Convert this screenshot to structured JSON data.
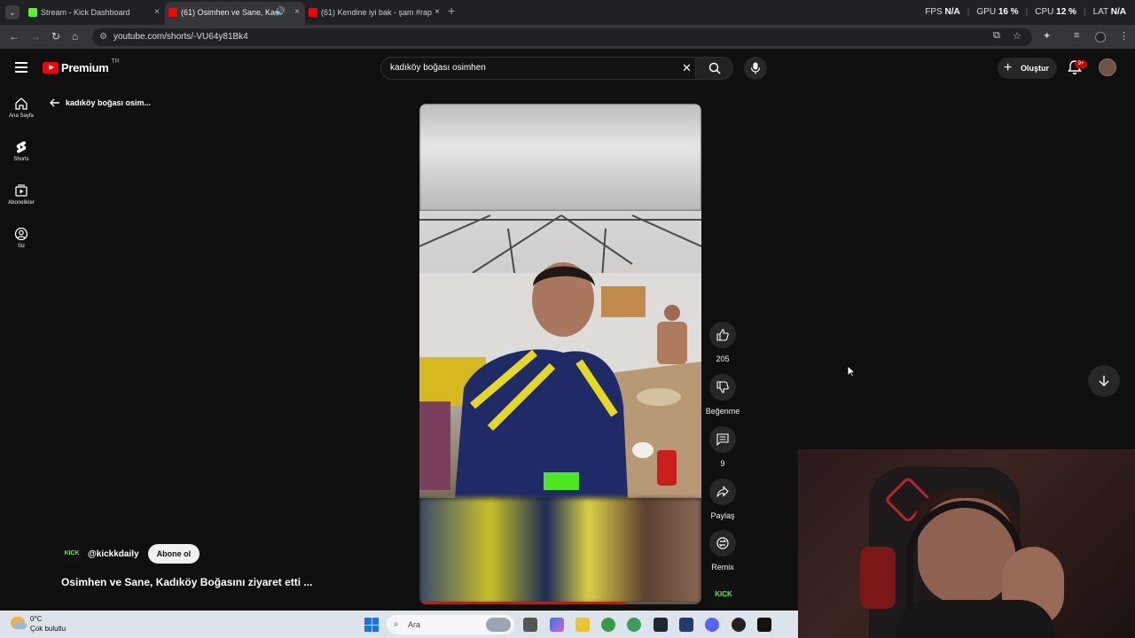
{
  "browser": {
    "tabs": [
      {
        "label": "Stream - Kick Dashboard",
        "close": "×"
      },
      {
        "label": "(61) Osimhen ve Sane, Kadı",
        "close": "×"
      },
      {
        "label": "(61) Kendine iyi bak - şam #rap",
        "close": "×"
      }
    ],
    "new_tab": "+",
    "url": "youtube.com/shorts/-VU64y81Bk4"
  },
  "overlay_stats": [
    {
      "label": "FPS",
      "value": "N/A"
    },
    {
      "label": "GPU",
      "value": "16 %"
    },
    {
      "label": "CPU",
      "value": "12 %"
    },
    {
      "label": "LAT",
      "value": "N/A"
    }
  ],
  "youtube": {
    "logo_text": "Premium",
    "country_code": "TR",
    "search_query": "kadıköy boğası osimhen",
    "create_label": "Oluştur",
    "notif_badge": "9+",
    "sidebar": [
      {
        "label": "Ana Sayfa",
        "icon": "home-icon"
      },
      {
        "label": "Shorts",
        "icon": "shorts-icon"
      },
      {
        "label": "Abonelikler",
        "icon": "subscriptions-icon"
      },
      {
        "label": "Siz",
        "icon": "account-icon"
      }
    ],
    "back_label": "kadıköy boğası osim...",
    "short": {
      "channel_logo": "KICK",
      "channel": "@kickkdaily",
      "subscribe": "Abone ol",
      "title": "Osimhen ve Sane, Kadıköy Boğasını ziyaret etti ...",
      "progress": 0.73,
      "actions": {
        "like_count": "205",
        "dislike_label": "Beğenme",
        "comment_count": "9",
        "share_label": "Paylaş",
        "remix_label": "Remix"
      },
      "next_thumb_label": "KICK"
    }
  },
  "taskbar": {
    "temp": "0°C",
    "weather": "Çok bulutlu",
    "search_placeholder": "Ara"
  },
  "colors": {
    "yt_red": "#ff0000",
    "kick_green": "#53fc18",
    "background": "#0f0f0f"
  }
}
